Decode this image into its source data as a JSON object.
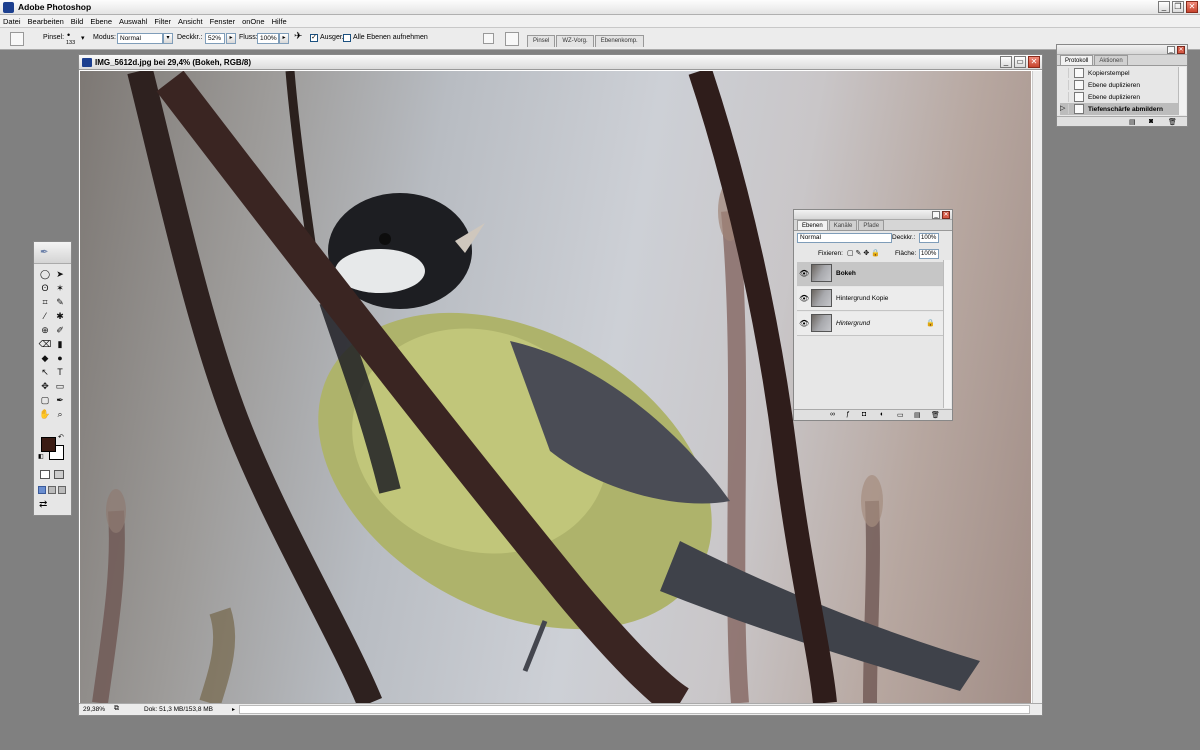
{
  "app": {
    "title": "Adobe Photoshop"
  },
  "menu": [
    "Datei",
    "Bearbeiten",
    "Bild",
    "Ebene",
    "Auswahl",
    "Filter",
    "Ansicht",
    "Fenster",
    "onOne",
    "Hilfe"
  ],
  "options": {
    "brush_label": "Pinsel:",
    "brush_size": "133",
    "mode_label": "Modus:",
    "mode_value": "Normal",
    "opacity_label": "Deckkr.:",
    "opacity_value": "52%",
    "flow_label": "Fluss:",
    "flow_value": "100%",
    "aligned_label": "Ausger.",
    "aligned_checked": "✓",
    "all_layers_label": "Alle Ebenen aufnehmen",
    "palette_tabs": [
      "Pinsel",
      "WZ-Vorg.",
      "Ebenenkomp."
    ]
  },
  "document": {
    "title": "IMG_5612d.jpg bei 29,4% (Bokeh, RGB/8)",
    "zoom": "29,38%",
    "doc_size": "Dok: 51,3 MB/153,8 MB"
  },
  "toolbox": {
    "tools": [
      "◯",
      "➤",
      "ʘ",
      "✶",
      "⌗",
      "✎",
      "⁄",
      "✱",
      "⊕",
      "✐",
      "⌫",
      "▮",
      "◆",
      "●",
      "↖",
      "T",
      "✥",
      "▭",
      "▢",
      "✒",
      "✋",
      "⌕"
    ],
    "fg_color": "#3b1c14",
    "bg_color": "#ffffff"
  },
  "history": {
    "tabs": [
      "Protokoll",
      "Aktionen"
    ],
    "items": [
      {
        "label": "Kopierstempel",
        "active": false
      },
      {
        "label": "Ebene duplizieren",
        "active": false
      },
      {
        "label": "Ebene duplizieren",
        "active": false
      },
      {
        "label": "Tiefenschärfe abmildern",
        "active": true
      }
    ]
  },
  "layers": {
    "tabs": [
      "Ebenen",
      "Kanäle",
      "Pfade"
    ],
    "blend_mode": "Normal",
    "opacity_label": "Deckkr.:",
    "opacity_value": "100%",
    "lock_label": "Fixieren:",
    "fill_label": "Fläche:",
    "fill_value": "100%",
    "items": [
      {
        "name": "Bokeh",
        "visible": true,
        "active": true
      },
      {
        "name": "Hintergrund Kopie",
        "visible": true,
        "active": false
      },
      {
        "name": "Hintergrund",
        "visible": true,
        "active": false,
        "locked": true
      }
    ]
  }
}
